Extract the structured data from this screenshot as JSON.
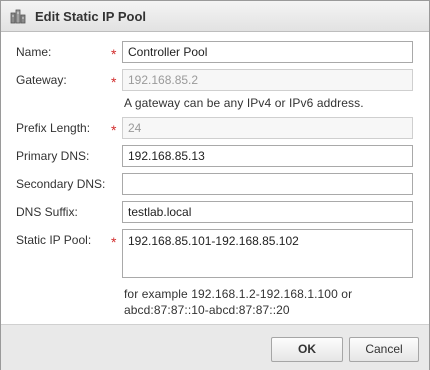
{
  "dialog": {
    "title": "Edit Static IP Pool",
    "icon": "ip-pool-icon"
  },
  "form": {
    "name": {
      "label": "Name:",
      "required": true,
      "value": "Controller Pool"
    },
    "gateway": {
      "label": "Gateway:",
      "required": true,
      "value": "192.168.85.2",
      "disabled": true,
      "hint": "A gateway can be any IPv4 or IPv6 address."
    },
    "prefix_length": {
      "label": "Prefix Length:",
      "required": true,
      "value": "24",
      "disabled": true
    },
    "primary_dns": {
      "label": "Primary DNS:",
      "value": "192.168.85.13"
    },
    "secondary_dns": {
      "label": "Secondary DNS:",
      "value": ""
    },
    "dns_suffix": {
      "label": "DNS Suffix:",
      "value": "testlab.local"
    },
    "static_ip_pool": {
      "label": "Static IP Pool:",
      "required": true,
      "value": "192.168.85.101-192.168.85.102",
      "hint_line1": "for example 192.168.1.2-192.168.1.100 or",
      "hint_line2": "abcd:87:87::10-abcd:87:87::20"
    },
    "required_marker": "*"
  },
  "buttons": {
    "ok": "OK",
    "cancel": "Cancel"
  },
  "colors": {
    "required": "#d22c2c",
    "footer_bg": "#e9e9e9"
  }
}
